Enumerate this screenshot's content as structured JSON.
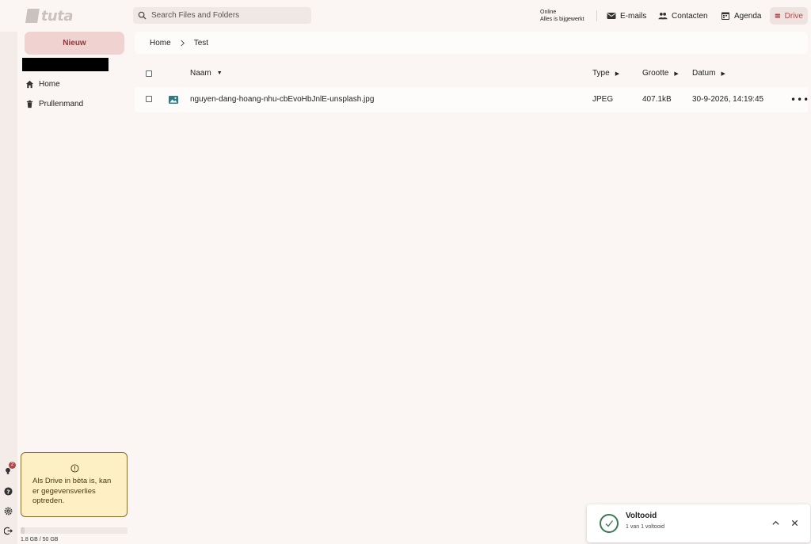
{
  "app": {
    "logo_text": "tuta",
    "brand_color": "#b04a4a"
  },
  "search": {
    "placeholder": "Search Files and Folders"
  },
  "status": {
    "line1": "Online",
    "line2": "Alles is bijgewerkt"
  },
  "nav": {
    "emails": "E-mails",
    "contacts": "Contacten",
    "calendar": "Agenda",
    "drive": "Drive"
  },
  "sidebar": {
    "new_label": "Nieuw",
    "items": [
      {
        "label": "Home",
        "icon": "home-icon"
      },
      {
        "label": "Prullenmand",
        "icon": "trash-icon"
      }
    ],
    "beta_notice": "Als Drive in bèta is, kan er gegevensverlies optreden.",
    "storage_label": "1.8 GB / 50 GB",
    "storage_used_fraction": 0.036
  },
  "left_strip": {
    "notification_count": "2"
  },
  "breadcrumb": {
    "items": [
      "Home",
      "Test"
    ]
  },
  "table": {
    "columns": {
      "name": "Naam",
      "type": "Type",
      "size": "Grootte",
      "date": "Datum"
    },
    "rows": [
      {
        "name": "nguyen-dang-hoang-nhu-cbEvoHbJnlE-unsplash.jpg",
        "type": "JPEG",
        "size": "407.1kB",
        "date": "30-9-2026, 14:19:45"
      }
    ]
  },
  "toast": {
    "title": "Voltooid",
    "subtitle": "1 van 1 voltooid"
  }
}
